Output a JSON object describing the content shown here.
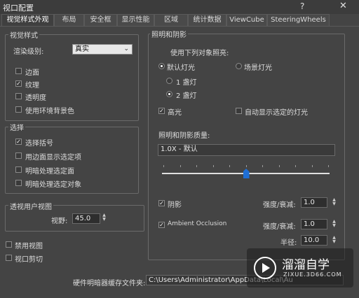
{
  "window": {
    "title": "视口配置",
    "help": "?",
    "close": "✕"
  },
  "tabs": [
    {
      "label": "视觉样式外观"
    },
    {
      "label": "布局"
    },
    {
      "label": "安全框"
    },
    {
      "label": "显示性能"
    },
    {
      "label": "区域"
    },
    {
      "label": "统计数据"
    },
    {
      "label": "ViewCube"
    },
    {
      "label": "SteeringWheels"
    }
  ],
  "visual_style": {
    "group_label": "视觉样式",
    "render_level_label": "渲染级别:",
    "render_level_value": "真实",
    "options": [
      {
        "label": "边面",
        "checked": false
      },
      {
        "label": "纹理",
        "checked": true
      },
      {
        "label": "透明度",
        "checked": false
      },
      {
        "label": "使用环境背景色",
        "checked": false
      }
    ]
  },
  "selection": {
    "group_label": "选择",
    "options": [
      {
        "label": "选择括号",
        "checked": true
      },
      {
        "label": "用边面显示选定项",
        "checked": false
      },
      {
        "label": "明暗处理选定面",
        "checked": false
      },
      {
        "label": "明暗处理选定对象",
        "checked": false
      }
    ]
  },
  "perspective": {
    "group_label": "透视用户视图",
    "fov_label": "视野:",
    "fov_value": "45.0"
  },
  "bottom_left": {
    "disable_view": {
      "label": "禁用视图",
      "checked": false
    },
    "viewport_clip": {
      "label": "视口剪切",
      "checked": false
    }
  },
  "lighting": {
    "group_label": "照明和阴影",
    "illuminate_label": "使用下列对象照亮:",
    "default_lights": "默认灯光",
    "scene_lights": "场景灯光",
    "one_light": "1 盏灯",
    "two_lights": "2 盏灯",
    "highlights": {
      "label": "高光",
      "checked": true
    },
    "auto_selected": {
      "label": "自动显示选定的灯光",
      "checked": false
    },
    "quality_label": "照明和阴影质量:",
    "quality_value": "1.0X - 默认",
    "slider_level": 0.5,
    "shadows": {
      "label": "阴影",
      "checked": true
    },
    "shadow_intensity_label": "强度/衰减:",
    "shadow_intensity_value": "1.0",
    "ao": {
      "label": "Ambient Occlusion",
      "checked": true
    },
    "ao_intensity_label": "强度/衰减:",
    "ao_intensity_value": "1.0",
    "radius_label": "半径:",
    "radius_value": "10.0"
  },
  "cache": {
    "label": "硬件明暗器缓存文件夹:",
    "path": "C:\\Users\\Administrator\\AppData\\Local\\Au"
  },
  "watermark": {
    "text": "溜溜自学",
    "url": "ZIXUE.3D66.COM"
  },
  "colors": {
    "background": "#444444",
    "accent": "#1f6fd6"
  },
  "icons": [
    "close-icon",
    "help-icon",
    "chevron-down-icon",
    "checkmark-icon",
    "spinner-arrows-icon",
    "play-icon"
  ]
}
